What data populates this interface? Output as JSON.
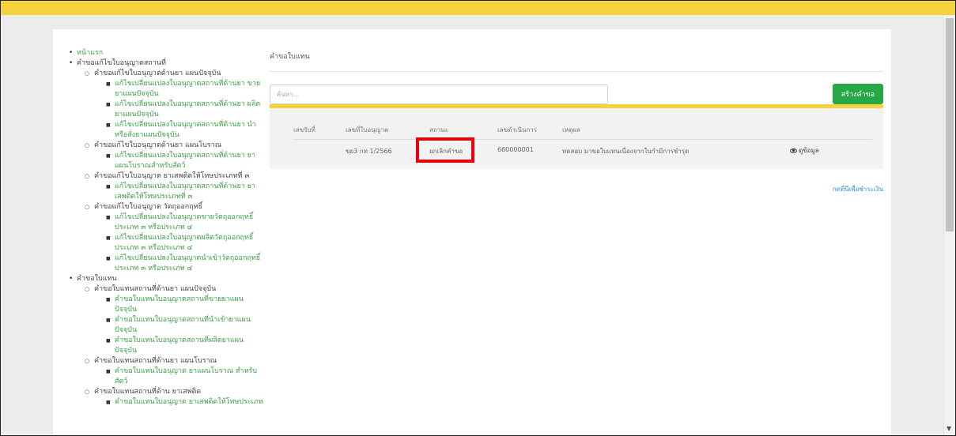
{
  "sidebar": {
    "items": [
      {
        "level": 1,
        "label": "หน้าแรก",
        "link": true
      },
      {
        "level": 1,
        "label": "คำขอแก้ไขใบอนุญาตสถานที่",
        "link": false
      },
      {
        "level": 2,
        "label": "คำขอแก้ไขใบอนุญาตด้านยา แผนปัจจุบัน",
        "link": false
      },
      {
        "level": 3,
        "label": "แก้ไขเปลี่ยนแปลงใบอนุญาตสถานที่ด้านยา ขายยาแผนปัจจุบัน",
        "link": true
      },
      {
        "level": 3,
        "label": "แก้ไขเปลี่ยนแปลงใบอนุญาตสถานที่ด้านยา ผลิตยาแผนปัจจุบัน",
        "link": true
      },
      {
        "level": 3,
        "label": "แก้ไขเปลี่ยนแปลงใบอนุญาตสถานที่ด้านยา นำหรือสั่งยาแผนปัจจุบัน",
        "link": true
      },
      {
        "level": 2,
        "label": "คำขอแก้ไขใบอนุญาตด้านยา แผนโบราณ",
        "link": false
      },
      {
        "level": 3,
        "label": "แก้ไขเปลี่ยนแปลงใบอนุญาตสถานที่ด้านยา ยาแผนโบราณสำหรับสัตว์",
        "link": true
      },
      {
        "level": 2,
        "label": "คำขอแก้ไขใบอนุญาต ยาเสพติดให้โทษประเภทที่ ๓",
        "link": false
      },
      {
        "level": 3,
        "label": "แก้ไขเปลี่ยนแปลงใบอนุญาตสถานที่ด้านยา ยาเสพติดให้โทษประเภทที่ ๓",
        "link": true
      },
      {
        "level": 2,
        "label": "คำขอแก้ไขใบอนุญาต วัตถุออกฤทธิ์",
        "link": false
      },
      {
        "level": 3,
        "label": "แก้ไขเปลี่ยนแปลงใบอนุญาตขายวัตถุออกฤทธิ์ ประเภท ๓ หรือประเภท ๔",
        "link": true
      },
      {
        "level": 3,
        "label": "แก้ไขเปลี่ยนแปลงใบอนุญาตผลิตวัตถุออกฤทธิ์ ประเภท ๓ หรือประเภท ๔",
        "link": true
      },
      {
        "level": 3,
        "label": "แก้ไขเปลี่ยนแปลงใบอนุญาตนำเข้าวัตถุออกฤทธิ์ ประเภท ๓ หรือประเภท ๔",
        "link": true
      },
      {
        "level": 1,
        "label": "คำขอใบแทน",
        "link": false
      },
      {
        "level": 2,
        "label": "คำขอใบแทนสถานที่ด้านยา แผนปัจจุบัน",
        "link": false
      },
      {
        "level": 3,
        "label": "คำขอใบแทนใบอนุญาตสถานที่ขายยาแผนปัจจุบัน",
        "link": true
      },
      {
        "level": 3,
        "label": "คำขอใบแทนใบอนุญาตสถานที่นำเข้ายาแผนปัจจุบัน",
        "link": true
      },
      {
        "level": 3,
        "label": "คำขอใบแทนใบอนุญาตสถานที่ผลิตยาแผนปัจจุบัน",
        "link": true
      },
      {
        "level": 2,
        "label": "คำขอใบแทนสถานที่ด้านยา แผนโบราณ",
        "link": false
      },
      {
        "level": 3,
        "label": "คำขอใบแทนใบอนุญาต ยาแผนโบราณ สำหรับสัตว์",
        "link": true
      },
      {
        "level": 2,
        "label": "คำขอใบแทนสถานที่ด้าน ยาเสพติด",
        "link": false
      },
      {
        "level": 3,
        "label": "คำขอใบแทนใบอนุญาต ยาเสพติดให้โทษประเภท",
        "link": true
      }
    ]
  },
  "main": {
    "title": "คำขอใบแทน",
    "search_placeholder": "ค้นหา...",
    "create_button": "สร้างคำขอ",
    "table": {
      "headers": [
        "เลขรับที่",
        "เลขที่ใบอนุญาต",
        "สถานะ",
        "เลขดำเนินการ",
        "เหตุผล"
      ],
      "rows": [
        {
          "receive_no": "",
          "license_no": "ขย3 กท 1/2566",
          "status": "ยกเลิกคำขอ",
          "process_no": "660000001",
          "reason": "ทดสอบ มาขอใบแทนเนื่องจากใบกำมีการชำรุด",
          "action": "ดูข้อมูล"
        }
      ]
    },
    "pay_link": "กดที่นี่เพื่อชำระเงิน",
    "highlight_color": "#e8000a"
  }
}
